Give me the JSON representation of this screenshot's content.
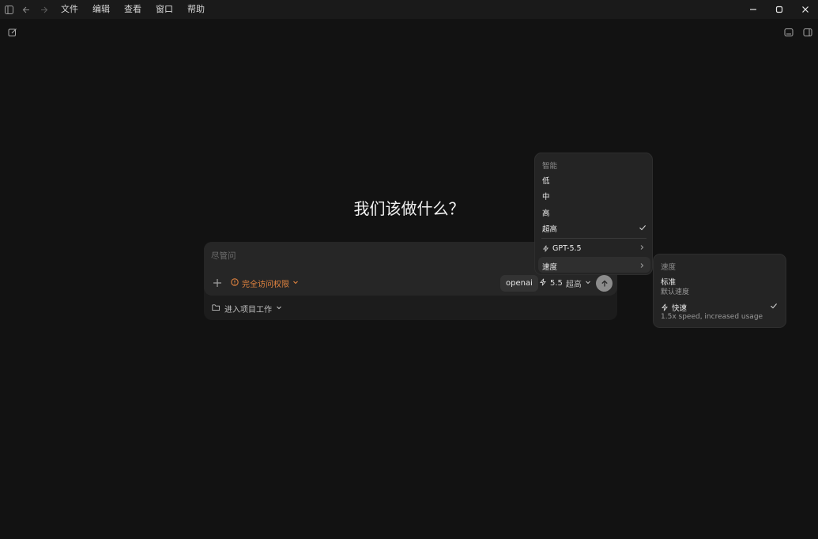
{
  "menubar": {
    "items": [
      "文件",
      "编辑",
      "查看",
      "窗口",
      "帮助"
    ]
  },
  "icons": {
    "sidebar": "sidebar-toggle-icon",
    "back": "arrow-left-icon",
    "forward": "arrow-right-icon",
    "new_chat": "compose-icon",
    "panel_bottom": "bottom-panel-icon",
    "panel_right": "right-panel-icon"
  },
  "main": {
    "heading": "我们该做什么？"
  },
  "composer": {
    "placeholder": "尽管问",
    "permission_label": "完全访问权限",
    "provider": "openai",
    "model_short": "5.5",
    "effort": "超高",
    "project_label": "进入项目工作"
  },
  "dropdown": {
    "section_label": "智能",
    "effort_options": [
      "低",
      "中",
      "高",
      "超高"
    ],
    "model_item": "GPT-5.5",
    "speed_item": "速度"
  },
  "speed_menu": {
    "section_label": "速度",
    "options": [
      {
        "title": "标准",
        "desc": "默认速度"
      },
      {
        "title": "快速",
        "desc": "1.5x speed, increased usage"
      }
    ]
  },
  "colors": {
    "accent_warning": "#e2843f",
    "background": "#121212",
    "panel": "#262626"
  }
}
